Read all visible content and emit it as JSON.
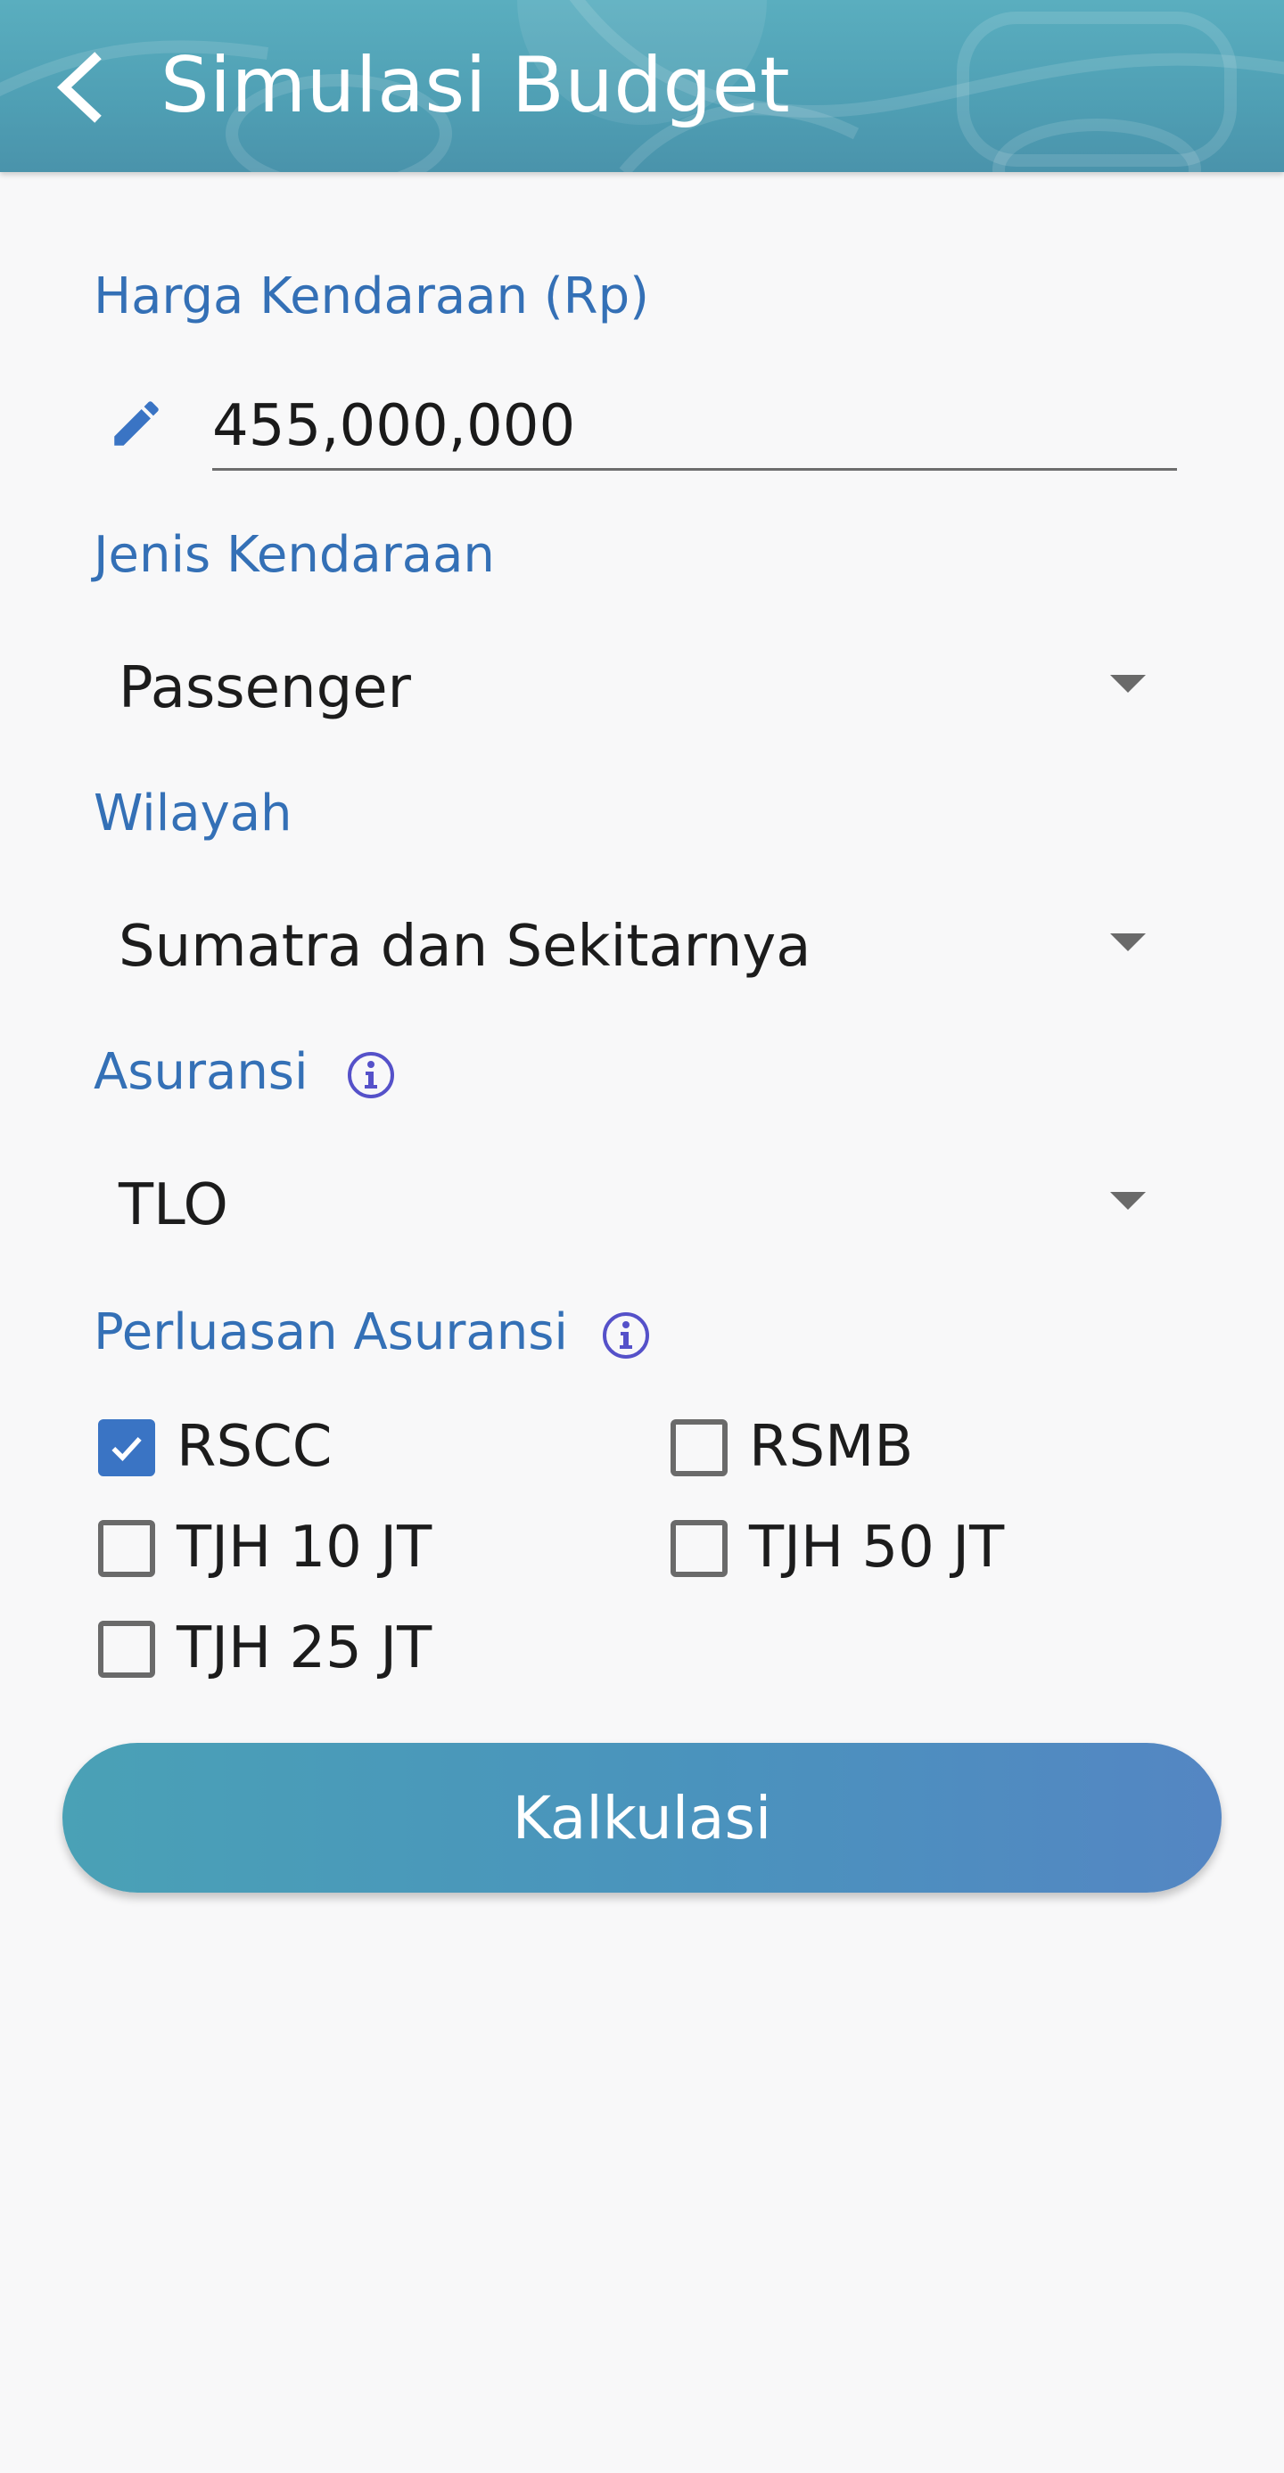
{
  "header": {
    "title": "Simulasi Budget",
    "back_icon": "chevron-left-icon"
  },
  "form": {
    "price": {
      "label": "Harga Kendaraan (Rp)",
      "value": "455,000,000",
      "icon": "pencil-icon"
    },
    "vehicle_type": {
      "label": "Jenis Kendaraan",
      "selected": "Passenger"
    },
    "region": {
      "label": "Wilayah",
      "selected": "Sumatra dan Sekitarnya"
    },
    "insurance": {
      "label": "Asuransi",
      "selected": "TLO",
      "info_icon": "info-icon"
    },
    "extension": {
      "label": "Perluasan Asuransi",
      "info_icon": "info-icon",
      "options": [
        {
          "label": "RSCC",
          "checked": true
        },
        {
          "label": "RSMB",
          "checked": false
        },
        {
          "label": "TJH 10 JT",
          "checked": false
        },
        {
          "label": "TJH 50 JT",
          "checked": false
        },
        {
          "label": "TJH 25 JT",
          "checked": false
        }
      ]
    }
  },
  "actions": {
    "calculate_label": "Kalkulasi"
  },
  "colors": {
    "accent": "#3470b6",
    "appbar": "#4f9fb4",
    "checkbox_checked": "#3a74c4"
  }
}
